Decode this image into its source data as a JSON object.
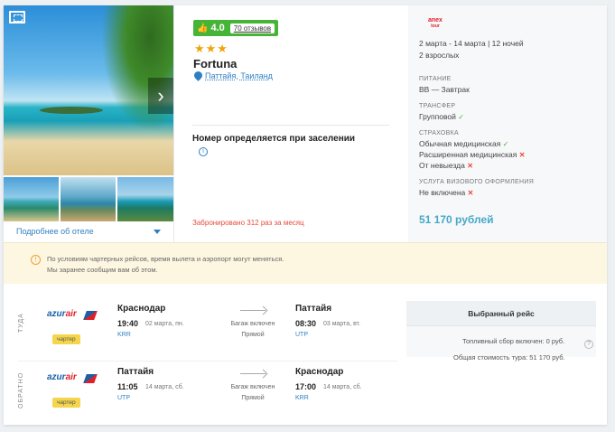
{
  "gallery": {
    "more_label": "Подробнее об отеле"
  },
  "hotel": {
    "rating": "4.0",
    "reviews": "70 отзывов",
    "stars": "★★★",
    "name": "Fortuna",
    "location": "Паттайя, Таиланд",
    "room": "Номер определяется при заселении",
    "booked": "Забронировано 312 раз за месяц"
  },
  "tour": {
    "operator_logo_line1": "anex",
    "operator_logo_line2": "tour",
    "dates": "2 марта - 14 марта | 12 ночей",
    "guests": "2 взрослых",
    "meal_label": "ПИТАНИЕ",
    "meal": "BB — Завтрак",
    "transfer_label": "ТРАНСФЕР",
    "transfer": "Групповой",
    "insurance_label": "СТРАХОВКА",
    "insurance_1": "Обычная медицинская",
    "insurance_2": "Расширенная медицинская",
    "insurance_3": "От невыезда",
    "visa_label": "УСЛУГА ВИЗОВОГО ОФОРМЛЕНИЯ",
    "visa": "Не включена",
    "price": "51 170 рублей",
    "check_mark": "✓",
    "cross_mark": "✕"
  },
  "notice": {
    "line1": "По условиям чартерных рейсов, время вылета и аэропорт могут меняться.",
    "line2": "Мы заранее сообщим вам об этом."
  },
  "flights": {
    "outbound": {
      "direction": "ТУДА",
      "airline_part1": "azur",
      "airline_part2": "air",
      "badge": "чартер",
      "from_city": "Краснодар",
      "dep_time": "19:40",
      "dep_date": "02 марта, пн.",
      "from_code": "KRR",
      "baggage": "Багаж включен",
      "type": "Прямой",
      "to_city": "Паттайя",
      "arr_time": "08:30",
      "arr_date": "03 марта, вт.",
      "to_code": "UTP"
    },
    "return": {
      "direction": "ОБРАТНО",
      "airline_part1": "azur",
      "airline_part2": "air",
      "badge": "чартер",
      "from_city": "Паттайя",
      "dep_time": "11:05",
      "dep_date": "14 марта, сб.",
      "from_code": "UTP",
      "baggage": "Багаж включен",
      "type": "Прямой",
      "to_city": "Краснодар",
      "arr_time": "17:00",
      "arr_date": "14 марта, сб.",
      "to_code": "KRR"
    }
  },
  "selected": {
    "title": "Выбранный рейс",
    "fuel": "Топливный сбор включен: 0 руб.",
    "total": "Общая стоимость тура: 51 170 руб.",
    "help": "?"
  },
  "colors": {
    "accent_blue": "#2e7fc3",
    "rating_green": "#46b437",
    "price_color": "#46a9c8",
    "warning_bg": "#fdf6e1"
  }
}
